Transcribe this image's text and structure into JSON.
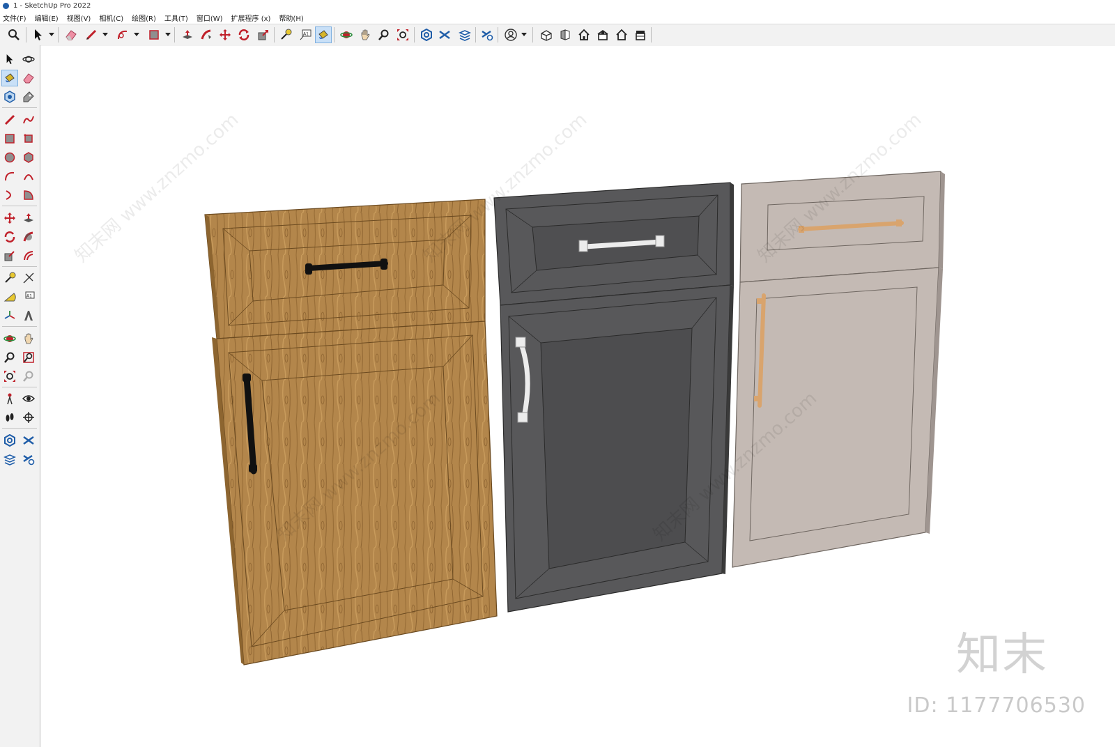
{
  "window": {
    "title": "1 - SketchUp Pro 2022"
  },
  "menu": [
    "文件(F)",
    "编辑(E)",
    "视图(V)",
    "相机(C)",
    "绘图(R)",
    "工具(T)",
    "窗口(W)",
    "扩展程序 (x)",
    "帮助(H)"
  ],
  "top_toolbar": [
    {
      "icon": "zoom-icon"
    },
    {
      "icon": "select-icon"
    },
    {
      "icon": "eraser-icon"
    },
    {
      "icon": "pencil-line-icon"
    },
    {
      "icon": "arc-icon"
    },
    {
      "icon": "rectangle-icon"
    },
    {
      "icon": "push-pull-icon"
    },
    {
      "icon": "follow-me-icon"
    },
    {
      "icon": "move-icon"
    },
    {
      "icon": "rotate-icon"
    },
    {
      "icon": "scale-icon"
    },
    {
      "icon": "tape-measure-icon"
    },
    {
      "icon": "text-label-icon"
    },
    {
      "icon": "paint-bucket-icon"
    },
    {
      "icon": "orbit-icon"
    },
    {
      "icon": "pan-icon"
    },
    {
      "icon": "zoom-window-icon"
    },
    {
      "icon": "zoom-extents-icon"
    },
    {
      "icon": "warehouse-icon"
    },
    {
      "icon": "extension-warehouse-icon"
    },
    {
      "icon": "layout-icon"
    },
    {
      "icon": "extension-manager-icon"
    },
    {
      "icon": "account-icon"
    },
    {
      "icon": "iso-view-icon"
    },
    {
      "icon": "front-view-icon"
    },
    {
      "icon": "top-view-icon"
    },
    {
      "icon": "right-view-icon"
    },
    {
      "icon": "back-view-icon"
    },
    {
      "icon": "left-view-icon"
    }
  ],
  "left_toolbar": [
    [
      "select-icon",
      "orbit-icon"
    ],
    [
      "paint-bucket-icon",
      "eraser-icon"
    ],
    [
      "component-icon",
      "tag-icon"
    ],
    [
      "pencil-line-icon",
      "freehand-icon"
    ],
    [
      "rectangle-icon",
      "rotated-rectangle-icon"
    ],
    [
      "circle-icon",
      "polygon-icon"
    ],
    [
      "arc-icon",
      "two-point-arc-icon"
    ],
    [
      "three-point-arc-icon",
      "pie-icon"
    ],
    [
      "move-icon",
      "push-pull-icon"
    ],
    [
      "rotate-icon",
      "follow-me-icon"
    ],
    [
      "scale-icon",
      "offset-icon"
    ],
    [
      "tape-measure-icon",
      "dimension-icon"
    ],
    [
      "protractor-icon",
      "text-label-icon"
    ],
    [
      "axes-icon",
      "3d-text-icon"
    ],
    [
      "orbit-icon",
      "pan-icon"
    ],
    [
      "zoom-icon",
      "zoom-window-icon"
    ],
    [
      "zoom-extents-icon",
      "previous-view-icon"
    ],
    [
      "position-camera-icon",
      "look-around-icon"
    ],
    [
      "walk-icon",
      "section-plane-icon"
    ],
    [
      "warehouse-icon",
      "extension-warehouse-icon"
    ],
    [
      "layout-icon",
      "extension-manager-icon"
    ]
  ],
  "model": {
    "doors": [
      {
        "name": "oak-door",
        "color": "#b3864b",
        "handle": "#111111"
      },
      {
        "name": "charcoal-door",
        "color": "#58585a",
        "handle": "#ececec"
      },
      {
        "name": "greige-door",
        "color": "#c4bab4",
        "handle": "#d9a46d"
      }
    ]
  },
  "watermark": {
    "brand": "知末",
    "id": "ID: 1177706530",
    "diagonal": "知末网 www.znzmo.com"
  }
}
